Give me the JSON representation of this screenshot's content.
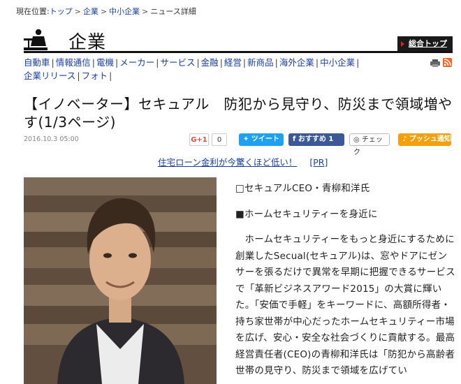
{
  "breadcrumb": {
    "prefix": "現在位置:",
    "items": [
      "トップ",
      "企業",
      "中小企業",
      "ニュース詳細"
    ]
  },
  "section": {
    "title": "企業",
    "top_link": "総合トップ"
  },
  "categories": [
    "自動車",
    "情報通信",
    "電機",
    "メーカー",
    "サービス",
    "金融",
    "経営",
    "新商品",
    "海外企業",
    "中小企業",
    "企業リリース",
    "フォト"
  ],
  "article": {
    "headline": "【イノベーター】セキュアル　防犯から見守り、防災まで領域増やす(1/3ページ)",
    "date": "2016.10.3 05:00",
    "caption": "□セキュアルCEO・青柳和洋氏",
    "subhead": "■ホームセキュリティーを身近に",
    "body": "ホームセキュリティーをもっと身近にするために創業したSecual(セキュアル)は、窓やドアにゼンサーを張るだけで異常を早期に把握できるサービスで「革新ビジネスアワード2015」の大賞に輝いた。「安価で手軽」をキーワードに、高額所得者・持ち家世帯が中心だったホームセキュリティー市場を広げ、安心・安全な社会づくりに貢献する。最高経営責任者(CEO)の青柳和洋氏は「防犯から高齢者世帯の見守り、防災まで領域を広げてい"
  },
  "share": {
    "gplus": "G+1",
    "gplus_count": "0",
    "tweet": "ツイート",
    "facebook": "おすすめ 1",
    "check": "チェック",
    "push": "プッシュ通知"
  },
  "ad": {
    "text": "住宅ローン金利が今驚くほど低い！",
    "tag": "[PR]"
  },
  "colors": {
    "link": "#1a3fa0",
    "twitter": "#1da1f2",
    "facebook": "#3b5998",
    "push": "#f5a00a"
  }
}
